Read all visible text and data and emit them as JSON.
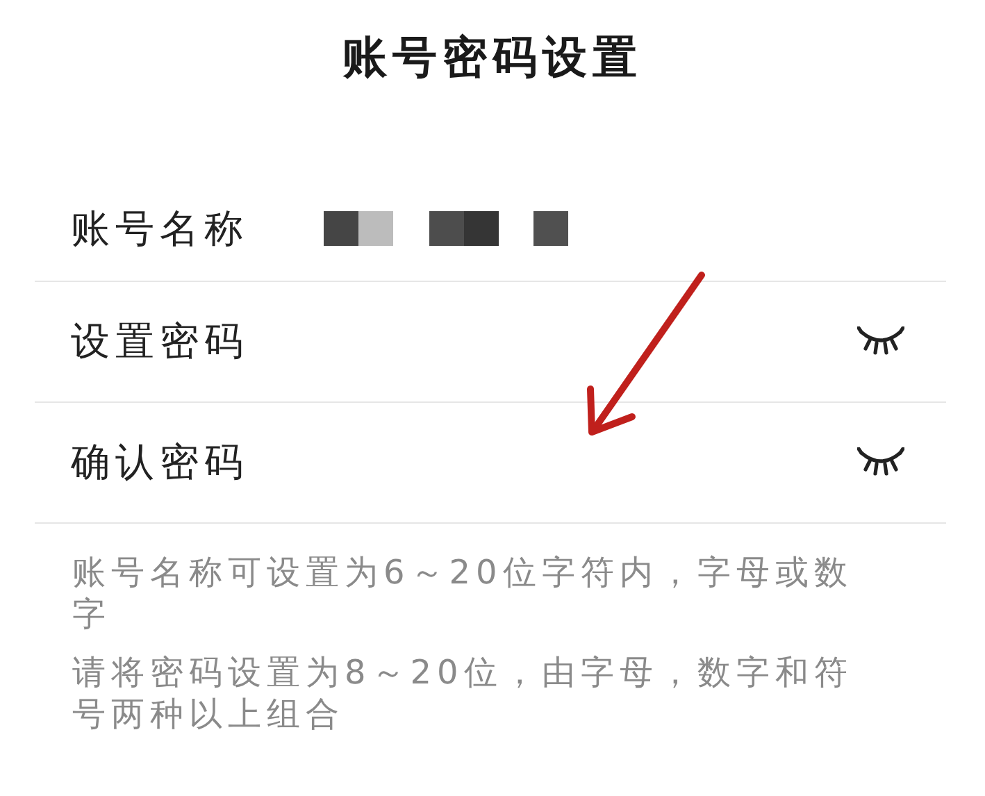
{
  "title": "账号密码设置",
  "fields": [
    {
      "label": "账号名称",
      "kind": "redacted"
    },
    {
      "label": "设置密码",
      "kind": "password",
      "visible": false
    },
    {
      "label": "确认密码",
      "kind": "password",
      "visible": false
    }
  ],
  "hints": [
    "账号名称可设置为6～20位字符内，字母或数字",
    "请将密码设置为8～20位，由字母，数字和符号两种以上组合"
  ],
  "annotation": {
    "kind": "arrow",
    "color": "#c0201c"
  }
}
